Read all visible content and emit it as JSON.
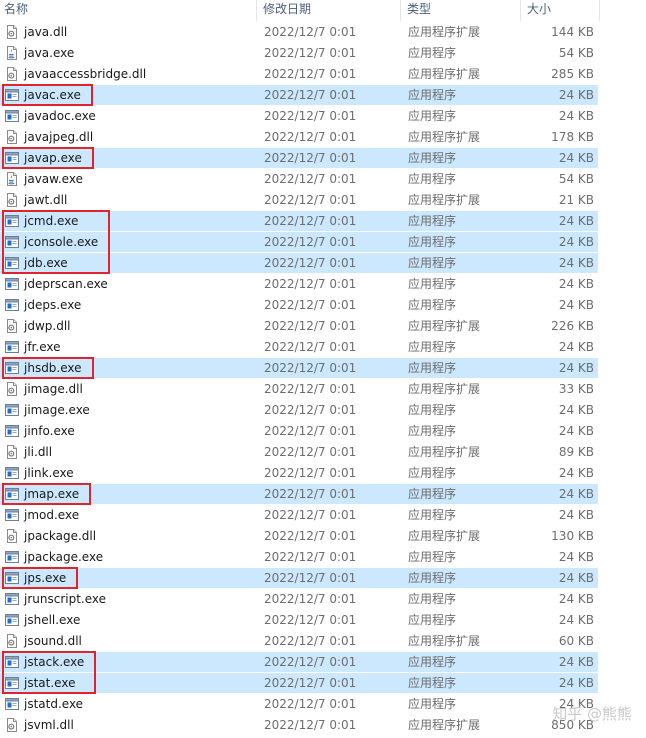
{
  "header": {
    "name": "名称",
    "date": "修改日期",
    "type": "类型",
    "size": "大小"
  },
  "files": [
    {
      "name": "java.dll",
      "date": "2022/12/7 0:01",
      "type": "应用程序扩展",
      "size": "144 KB",
      "icon": "dll-icon",
      "selected": false
    },
    {
      "name": "java.exe",
      "date": "2022/12/7 0:01",
      "type": "应用程序",
      "size": "54 KB",
      "icon": "java-exe-icon",
      "selected": false
    },
    {
      "name": "javaaccessbridge.dll",
      "date": "2022/12/7 0:01",
      "type": "应用程序扩展",
      "size": "285 KB",
      "icon": "dll-icon",
      "selected": false
    },
    {
      "name": "javac.exe",
      "date": "2022/12/7 0:01",
      "type": "应用程序",
      "size": "24 KB",
      "icon": "exe-window-icon",
      "selected": true
    },
    {
      "name": "javadoc.exe",
      "date": "2022/12/7 0:01",
      "type": "应用程序",
      "size": "24 KB",
      "icon": "exe-window-icon",
      "selected": false
    },
    {
      "name": "javajpeg.dll",
      "date": "2022/12/7 0:01",
      "type": "应用程序扩展",
      "size": "178 KB",
      "icon": "dll-icon",
      "selected": false
    },
    {
      "name": "javap.exe",
      "date": "2022/12/7 0:01",
      "type": "应用程序",
      "size": "24 KB",
      "icon": "exe-window-icon",
      "selected": true
    },
    {
      "name": "javaw.exe",
      "date": "2022/12/7 0:01",
      "type": "应用程序",
      "size": "54 KB",
      "icon": "java-exe-icon",
      "selected": false
    },
    {
      "name": "jawt.dll",
      "date": "2022/12/7 0:01",
      "type": "应用程序扩展",
      "size": "21 KB",
      "icon": "dll-icon",
      "selected": false
    },
    {
      "name": "jcmd.exe",
      "date": "2022/12/7 0:01",
      "type": "应用程序",
      "size": "24 KB",
      "icon": "exe-window-icon",
      "selected": true
    },
    {
      "name": "jconsole.exe",
      "date": "2022/12/7 0:01",
      "type": "应用程序",
      "size": "24 KB",
      "icon": "exe-window-icon",
      "selected": true
    },
    {
      "name": "jdb.exe",
      "date": "2022/12/7 0:01",
      "type": "应用程序",
      "size": "24 KB",
      "icon": "exe-window-icon",
      "selected": true
    },
    {
      "name": "jdeprscan.exe",
      "date": "2022/12/7 0:01",
      "type": "应用程序",
      "size": "24 KB",
      "icon": "exe-window-icon",
      "selected": false
    },
    {
      "name": "jdeps.exe",
      "date": "2022/12/7 0:01",
      "type": "应用程序",
      "size": "24 KB",
      "icon": "exe-window-icon",
      "selected": false
    },
    {
      "name": "jdwp.dll",
      "date": "2022/12/7 0:01",
      "type": "应用程序扩展",
      "size": "226 KB",
      "icon": "dll-icon",
      "selected": false
    },
    {
      "name": "jfr.exe",
      "date": "2022/12/7 0:01",
      "type": "应用程序",
      "size": "24 KB",
      "icon": "exe-window-icon",
      "selected": false
    },
    {
      "name": "jhsdb.exe",
      "date": "2022/12/7 0:01",
      "type": "应用程序",
      "size": "24 KB",
      "icon": "exe-window-icon",
      "selected": true
    },
    {
      "name": "jimage.dll",
      "date": "2022/12/7 0:01",
      "type": "应用程序扩展",
      "size": "33 KB",
      "icon": "dll-icon",
      "selected": false
    },
    {
      "name": "jimage.exe",
      "date": "2022/12/7 0:01",
      "type": "应用程序",
      "size": "24 KB",
      "icon": "exe-window-icon",
      "selected": false
    },
    {
      "name": "jinfo.exe",
      "date": "2022/12/7 0:01",
      "type": "应用程序",
      "size": "24 KB",
      "icon": "exe-window-icon",
      "selected": false
    },
    {
      "name": "jli.dll",
      "date": "2022/12/7 0:01",
      "type": "应用程序扩展",
      "size": "89 KB",
      "icon": "dll-icon",
      "selected": false
    },
    {
      "name": "jlink.exe",
      "date": "2022/12/7 0:01",
      "type": "应用程序",
      "size": "24 KB",
      "icon": "exe-window-icon",
      "selected": false
    },
    {
      "name": "jmap.exe",
      "date": "2022/12/7 0:01",
      "type": "应用程序",
      "size": "24 KB",
      "icon": "exe-window-icon",
      "selected": true
    },
    {
      "name": "jmod.exe",
      "date": "2022/12/7 0:01",
      "type": "应用程序",
      "size": "24 KB",
      "icon": "exe-window-icon",
      "selected": false
    },
    {
      "name": "jpackage.dll",
      "date": "2022/12/7 0:01",
      "type": "应用程序扩展",
      "size": "130 KB",
      "icon": "dll-icon",
      "selected": false
    },
    {
      "name": "jpackage.exe",
      "date": "2022/12/7 0:01",
      "type": "应用程序",
      "size": "24 KB",
      "icon": "exe-window-icon",
      "selected": false
    },
    {
      "name": "jps.exe",
      "date": "2022/12/7 0:01",
      "type": "应用程序",
      "size": "24 KB",
      "icon": "exe-window-icon",
      "selected": true
    },
    {
      "name": "jrunscript.exe",
      "date": "2022/12/7 0:01",
      "type": "应用程序",
      "size": "24 KB",
      "icon": "exe-window-icon",
      "selected": false
    },
    {
      "name": "jshell.exe",
      "date": "2022/12/7 0:01",
      "type": "应用程序",
      "size": "24 KB",
      "icon": "exe-window-icon",
      "selected": false
    },
    {
      "name": "jsound.dll",
      "date": "2022/12/7 0:01",
      "type": "应用程序扩展",
      "size": "60 KB",
      "icon": "dll-icon",
      "selected": false
    },
    {
      "name": "jstack.exe",
      "date": "2022/12/7 0:01",
      "type": "应用程序",
      "size": "24 KB",
      "icon": "exe-window-icon",
      "selected": true
    },
    {
      "name": "jstat.exe",
      "date": "2022/12/7 0:01",
      "type": "应用程序",
      "size": "24 KB",
      "icon": "exe-window-icon",
      "selected": true
    },
    {
      "name": "jstatd.exe",
      "date": "2022/12/7 0:01",
      "type": "应用程序",
      "size": "24 KB",
      "icon": "exe-window-icon",
      "selected": false
    },
    {
      "name": "jsvml.dll",
      "date": "2022/12/7 0:01",
      "type": "应用程序扩展",
      "size": "850 KB",
      "icon": "dll-icon",
      "selected": false
    }
  ],
  "highlight_groups": [
    {
      "label": "javac",
      "rows": [
        3
      ]
    },
    {
      "label": "javap",
      "rows": [
        6
      ]
    },
    {
      "label": "jcmd-jconsole-jdb",
      "rows": [
        9,
        10,
        11
      ]
    },
    {
      "label": "jhsdb",
      "rows": [
        16
      ]
    },
    {
      "label": "jmap",
      "rows": [
        22
      ]
    },
    {
      "label": "jps",
      "rows": [
        26
      ]
    },
    {
      "label": "jstack-jstat",
      "rows": [
        30,
        31
      ]
    }
  ],
  "watermark": "知乎 @熊熊",
  "colors": {
    "selection": "#cce8ff",
    "highlight_box": "#e0242f",
    "header_text": "#4c607a",
    "meta_text": "#6d6d6d"
  }
}
